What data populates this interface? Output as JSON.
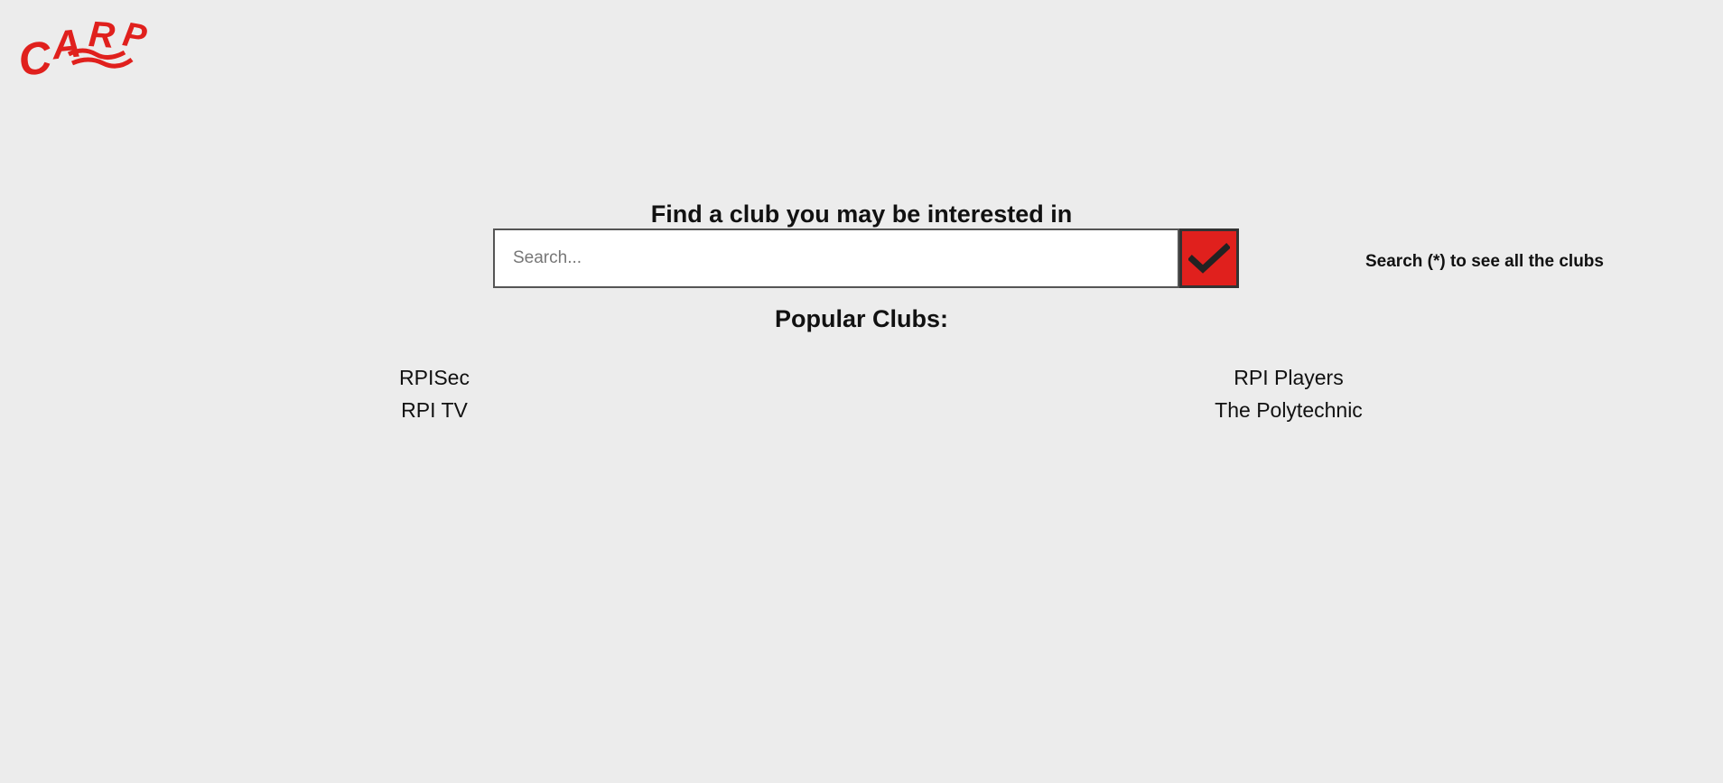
{
  "logo": {
    "text": "CARP",
    "color": "#e0201d"
  },
  "search": {
    "heading": "Find a club you may be interested in",
    "placeholder": "Search...",
    "value": "",
    "button_icon": "checkmark-icon",
    "hint": "Search (*) to see all the clubs"
  },
  "popular": {
    "heading": "Popular Clubs:",
    "left": [
      "RPISec",
      "RPI TV"
    ],
    "right": [
      "RPI Players",
      "The Polytechnic"
    ]
  },
  "colors": {
    "background": "#ececec",
    "accent": "#e0201d"
  }
}
